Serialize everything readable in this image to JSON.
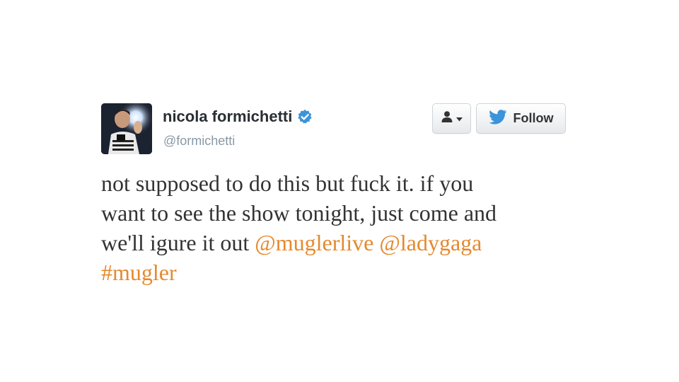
{
  "tweet": {
    "user": {
      "display_name": "nicola formichetti",
      "handle": "@formichetti",
      "verified": true,
      "avatar_icon": "profile-photo"
    },
    "actions": {
      "user_dropdown_icon": "user-silhouette-icon",
      "follow_label": "Follow",
      "follow_icon": "twitter-bird-icon"
    },
    "text": {
      "line1": "not supposed to do this but fuck it. if you",
      "line2": "want to see the show tonight, just come and",
      "line3_plain": "we'll igure it out ",
      "mention1": "@muglerlive",
      "mention2": "@ladygaga",
      "hashtag": "#mugler"
    }
  },
  "colors": {
    "link": "#e5892e",
    "text": "#333333",
    "name": "#292f33",
    "handle": "#8899a6",
    "verified": "#3b94d9",
    "twitter_bird": "#3b94d9"
  }
}
